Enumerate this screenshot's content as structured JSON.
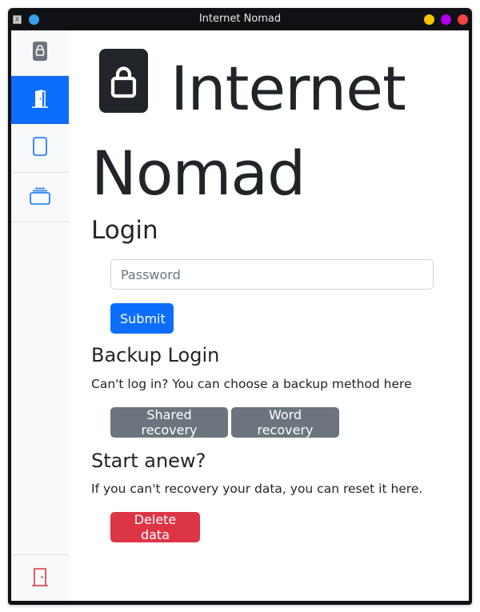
{
  "window": {
    "title": "Internet Nomad",
    "controls": {
      "minimize_color": "#f5c400",
      "maximize_color": "#b000e8",
      "close_color": "#f04545"
    }
  },
  "sidebar": {
    "items": [
      {
        "id": "lock",
        "icon": "lock-icon",
        "active": false
      },
      {
        "id": "door-open",
        "icon": "door-open-icon",
        "active": true
      },
      {
        "id": "page",
        "icon": "page-icon",
        "active": false
      },
      {
        "id": "stack",
        "icon": "collection-icon",
        "active": false
      }
    ],
    "footer_item": {
      "id": "exit",
      "icon": "door-closed-icon",
      "color": "#dc3545"
    },
    "active_color": "#0d6efd"
  },
  "header": {
    "title": "Internet Nomad",
    "icon": "lock-icon"
  },
  "login": {
    "heading": "Login",
    "password_placeholder": "Password",
    "password_value": "",
    "submit_label": "Submit"
  },
  "backup": {
    "heading": "Backup Login",
    "description": "Can't log in? You can choose a backup method here",
    "shared_recovery_label": "Shared recovery",
    "word_recovery_label": "Word recovery"
  },
  "reset": {
    "heading": "Start anew?",
    "description": "If you can't recovery your data, you can reset it here.",
    "delete_label": "Delete data"
  }
}
